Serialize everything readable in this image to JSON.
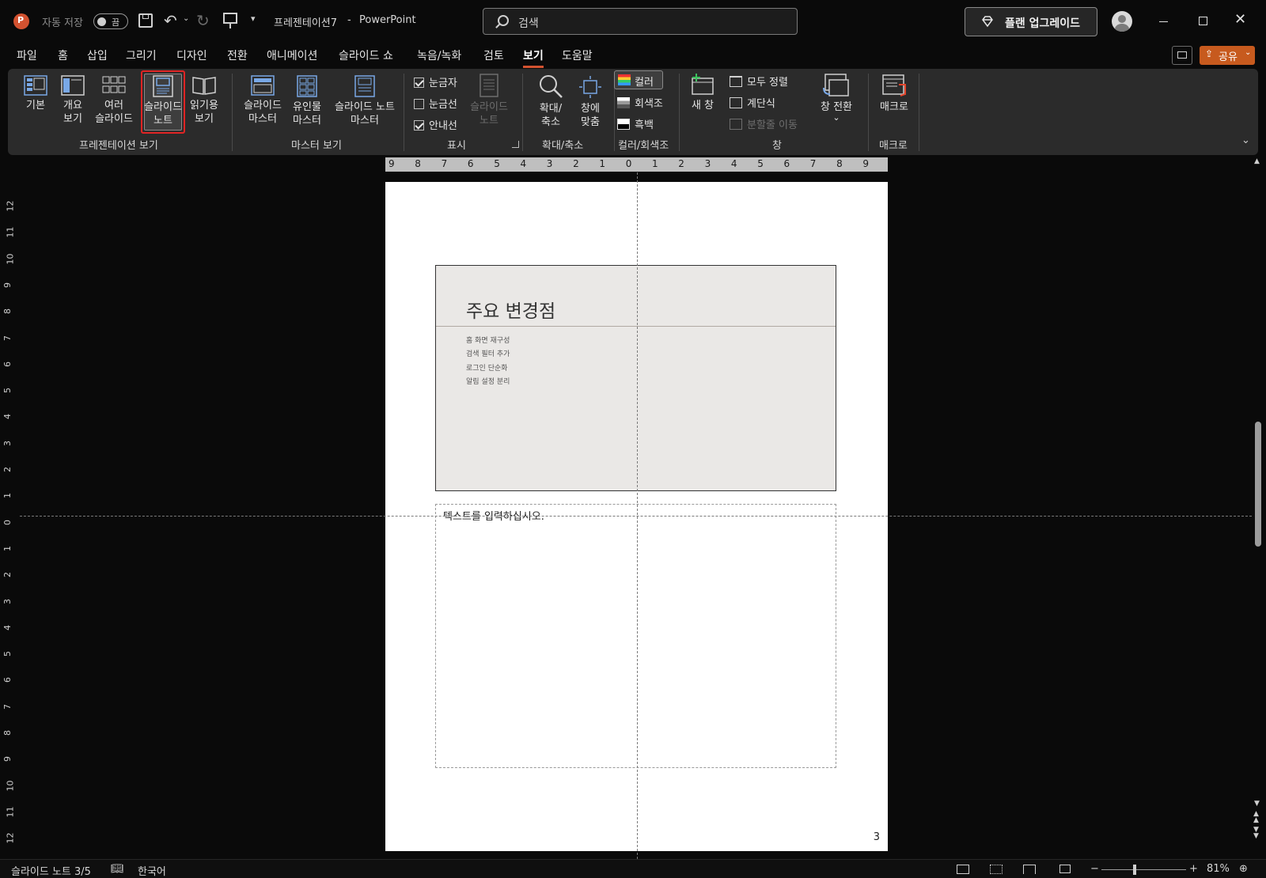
{
  "titlebar": {
    "autosave_label": "자동 저장",
    "autosave_state": "끔",
    "document_title": "프레젠테이션7",
    "separator": "-",
    "app_name": "PowerPoint",
    "search_placeholder": "검색",
    "upgrade_label": "플랜 업그레이드"
  },
  "tabs": [
    {
      "label": "파일"
    },
    {
      "label": "홈"
    },
    {
      "label": "삽입"
    },
    {
      "label": "그리기"
    },
    {
      "label": "디자인"
    },
    {
      "label": "전환"
    },
    {
      "label": "애니메이션"
    },
    {
      "label": "슬라이드 쇼"
    },
    {
      "label": "녹음/녹화"
    },
    {
      "label": "검토"
    },
    {
      "label": "보기"
    },
    {
      "label": "도움말"
    }
  ],
  "share_label": "공유",
  "ribbon": {
    "presentation_views": {
      "group_label": "프레젠테이션 보기",
      "normal": [
        "기본"
      ],
      "outline": [
        "개요",
        "보기"
      ],
      "sorter": [
        "여러",
        "슬라이드"
      ],
      "notes": [
        "슬라이드",
        "노트"
      ],
      "reading": [
        "읽기용",
        "보기"
      ]
    },
    "master_views": {
      "group_label": "마스터 보기",
      "slide_master": [
        "슬라이드",
        "마스터"
      ],
      "handout_master": [
        "유인물",
        "마스터"
      ],
      "notes_master": [
        "슬라이드 노트",
        "마스터"
      ]
    },
    "show": {
      "group_label": "표시",
      "ruler": "눈금자",
      "gridlines": "눈금선",
      "guides": "안내선",
      "notes": [
        "슬라이드",
        "노트"
      ]
    },
    "zoom": {
      "group_label": "확대/축소",
      "zoom": [
        "확대/",
        "축소"
      ],
      "fit": [
        "창에",
        "맞춤"
      ]
    },
    "color": {
      "group_label": "컬러/회색조",
      "color": "컬러",
      "grayscale": "회색조",
      "bw": "흑백"
    },
    "window": {
      "group_label": "창",
      "new_window": [
        "새 창"
      ],
      "arrange_all": "모두 정렬",
      "cascade": "계단식",
      "move_split": "분할줄 이동",
      "switch_windows": [
        "창 전환",
        "⌄"
      ]
    },
    "macros": {
      "group_label": "매크로",
      "macros": [
        "매크로"
      ]
    }
  },
  "ruler": {
    "h": [
      "9",
      "8",
      "7",
      "6",
      "5",
      "4",
      "3",
      "2",
      "1",
      "0",
      "1",
      "2",
      "3",
      "4",
      "5",
      "6",
      "7",
      "8",
      "9"
    ],
    "v": [
      "12",
      "11",
      "10",
      "9",
      "8",
      "7",
      "6",
      "5",
      "4",
      "3",
      "2",
      "1",
      "0",
      "1",
      "2",
      "3",
      "4",
      "5",
      "6",
      "7",
      "8",
      "9",
      "10",
      "11",
      "12"
    ]
  },
  "slide": {
    "title": "주요 변경점",
    "bullets": [
      "홈 화면 재구성",
      "검색 필터 추가",
      "로그인 단순화",
      "알림 설정 분리"
    ]
  },
  "notes_placeholder": "텍스트를 입력하십시오.",
  "page_number": "3",
  "status": {
    "slide_info": "슬라이드 노트 3/5",
    "language": "한국어",
    "zoom": "81%"
  },
  "colors": {
    "accent": "#d35230",
    "share_button": "#c75a1e",
    "selected_border": "#e02424"
  }
}
